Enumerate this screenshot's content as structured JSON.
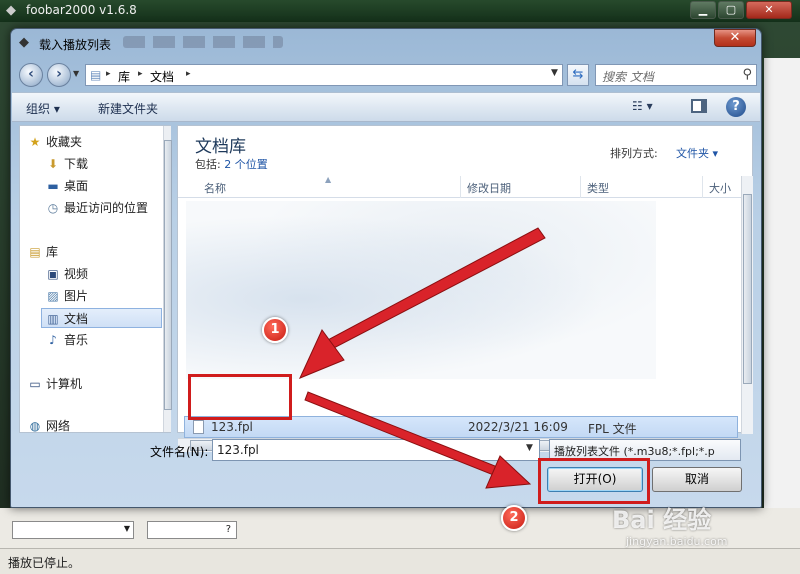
{
  "app": {
    "title": "foobar2000 v1.6.8",
    "status": "播放已停止。",
    "bottom_combo_hint": "?"
  },
  "dialog": {
    "title": "载入播放列表",
    "close_glyph": "✕"
  },
  "address": {
    "crumbs": [
      "库",
      "文档"
    ],
    "search_placeholder": "搜索 文档"
  },
  "toolbar": {
    "organize_label": "组织 ▾",
    "new_folder_label": "新建文件夹"
  },
  "sidebar": {
    "items": [
      {
        "label": "收藏夹",
        "icon": "star-icon"
      },
      {
        "label": "下载",
        "icon": "download-folder-icon"
      },
      {
        "label": "桌面",
        "icon": "desktop-icon"
      },
      {
        "label": "最近访问的位置",
        "icon": "recent-places-icon"
      },
      {
        "label": "库",
        "icon": "libraries-icon"
      },
      {
        "label": "视频",
        "icon": "video-icon"
      },
      {
        "label": "图片",
        "icon": "pictures-icon"
      },
      {
        "label": "文档",
        "icon": "documents-icon",
        "selected": true
      },
      {
        "label": "音乐",
        "icon": "music-icon"
      },
      {
        "label": "计算机",
        "icon": "computer-icon"
      },
      {
        "label": "网络",
        "icon": "network-icon"
      }
    ]
  },
  "main": {
    "library_title": "文档库",
    "includes_label": "包括:",
    "includes_link": "2 个位置",
    "arrange_label": "排列方式:",
    "arrange_value": "文件夹 ▾",
    "columns": [
      "名称",
      "修改日期",
      "类型",
      "大小"
    ],
    "file": {
      "name": "123.fpl",
      "modified": "2022/3/21 16:09",
      "type": "FPL 文件"
    }
  },
  "bottom": {
    "filename_label": "文件名(N):",
    "filename_value": "123.fpl",
    "filter_value": "播放列表文件 (*.m3u8;*.fpl;*.p",
    "open_label": "打开(O)",
    "cancel_label": "取消"
  },
  "annotations": {
    "step1": "1",
    "step2": "2",
    "color": "#d01c1c"
  },
  "watermark": {
    "brand": "Bai 经验",
    "url": "jingyan.baidu.com"
  }
}
